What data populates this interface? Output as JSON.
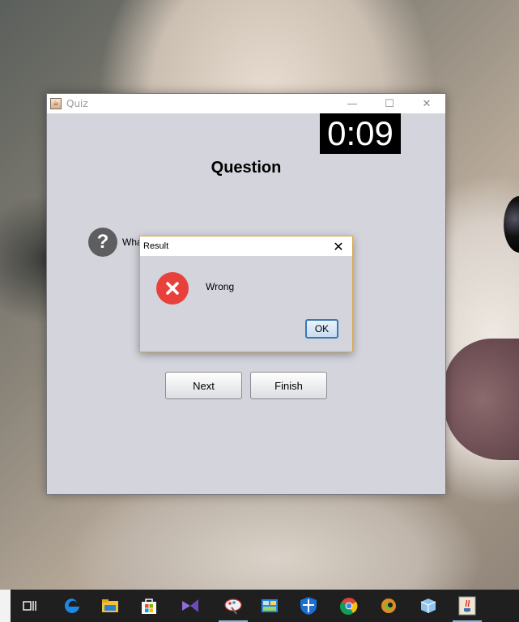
{
  "window": {
    "title": "Quiz",
    "controls": {
      "minimize": "—",
      "maximize": "☐",
      "close": "✕"
    }
  },
  "timer": "0:09",
  "main": {
    "heading": "Question",
    "question_icon": "question-icon",
    "question_text": "Wha",
    "next_label": "Next",
    "finish_label": "Finish"
  },
  "dialog": {
    "title": "Result",
    "close": "✕",
    "icon": "error-icon",
    "message": "Wrong",
    "ok_label": "OK"
  },
  "taskbar": {
    "items": [
      "task-view-icon",
      "edge-icon",
      "file-explorer-icon",
      "store-icon",
      "visual-studio-icon",
      "paint-icon",
      "control-panel-icon",
      "security-icon",
      "chrome-icon",
      "eclipse-icon",
      "cube-app-icon",
      "java-icon"
    ]
  },
  "colors": {
    "window_bg": "#d4d4dc",
    "timer_bg": "#000000",
    "error_red": "#e8413b",
    "dialog_border": "#d9a851",
    "taskbar_bg": "#1f1f1f"
  }
}
